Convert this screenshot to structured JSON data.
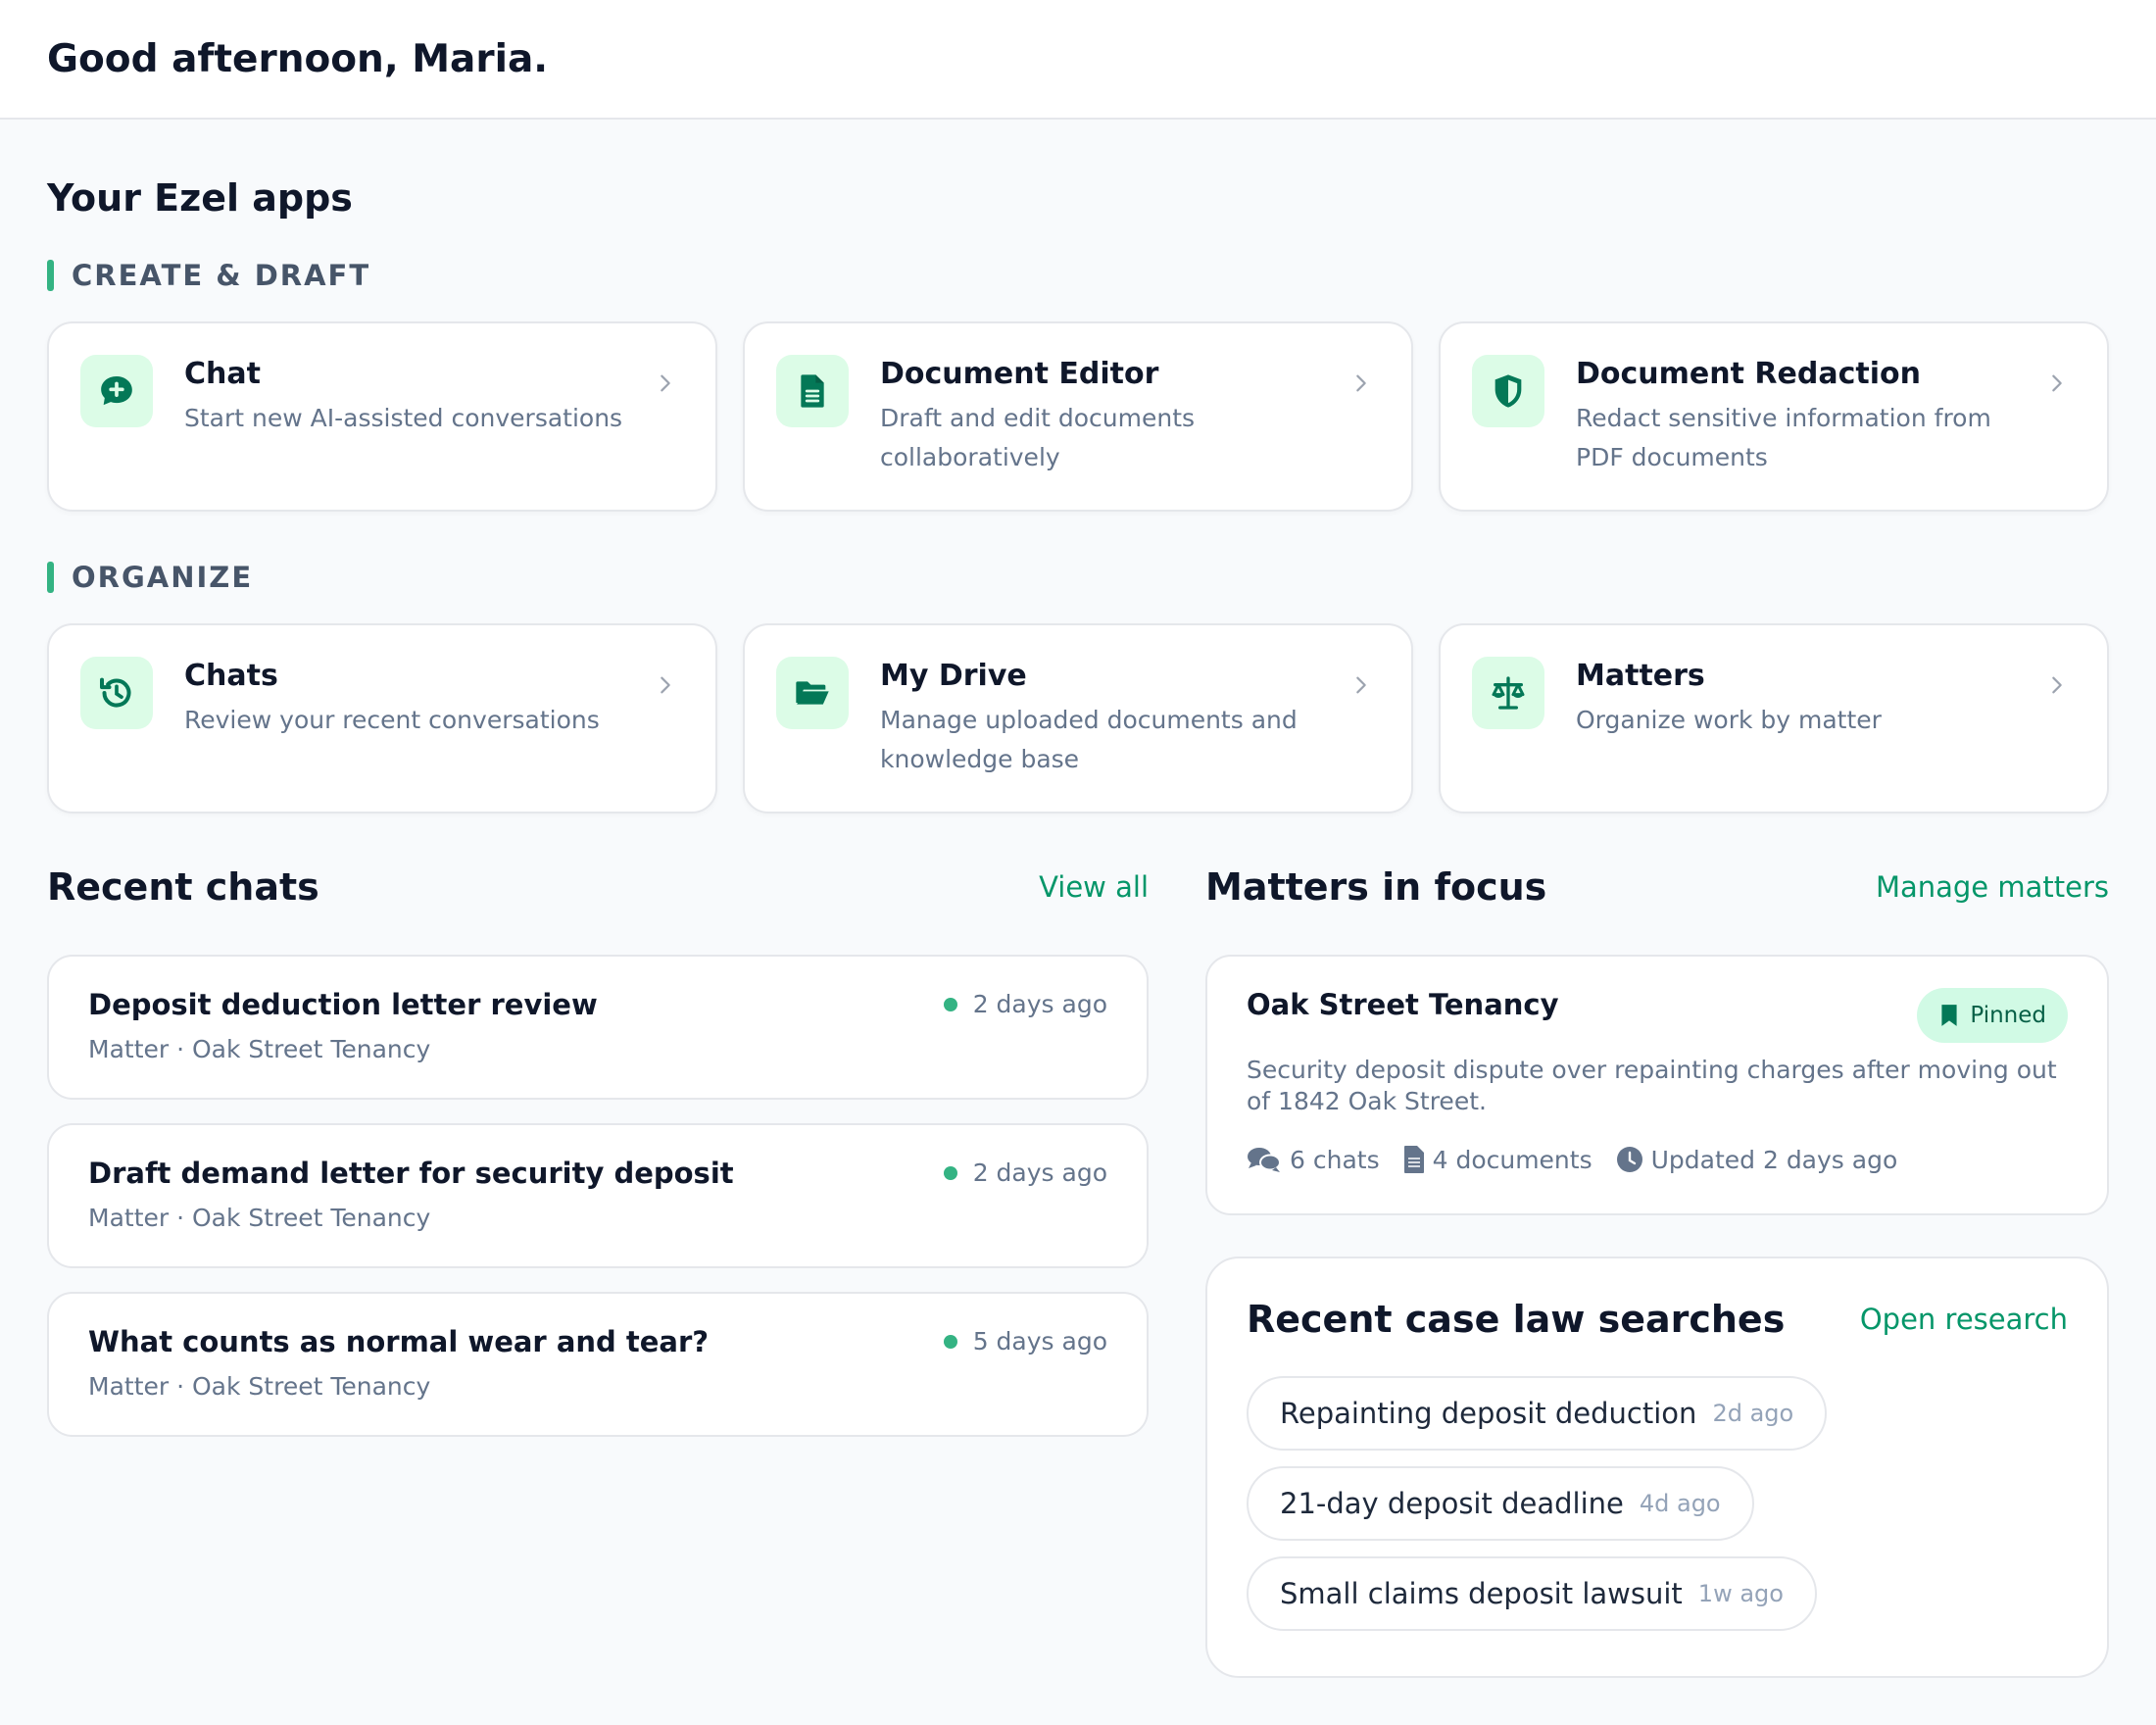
{
  "header": {
    "greeting": "Good afternoon, Maria."
  },
  "apps": {
    "title": "Your Ezel apps",
    "sections": [
      {
        "label": "CREATE & DRAFT",
        "items": [
          {
            "name": "Chat",
            "desc": "Start new AI-assisted conversations",
            "icon": "chat-plus-icon"
          },
          {
            "name": "Document Editor",
            "desc": "Draft and edit documents collaboratively",
            "icon": "document-icon"
          },
          {
            "name": "Document Redaction",
            "desc": "Redact sensitive information from PDF documents",
            "icon": "shield-icon"
          }
        ]
      },
      {
        "label": "ORGANIZE",
        "items": [
          {
            "name": "Chats",
            "desc": "Review your recent conversations",
            "icon": "history-icon"
          },
          {
            "name": "My Drive",
            "desc": "Manage uploaded documents and knowledge base",
            "icon": "folder-open-icon"
          },
          {
            "name": "Matters",
            "desc": "Organize work by matter",
            "icon": "scales-icon"
          }
        ]
      }
    ]
  },
  "recent_chats": {
    "title": "Recent chats",
    "view_all": "View all",
    "items": [
      {
        "title": "Deposit deduction letter review",
        "sub": "Matter · Oak Street Tenancy",
        "time": "2 days ago"
      },
      {
        "title": "Draft demand letter for security deposit",
        "sub": "Matter · Oak Street Tenancy",
        "time": "2 days ago"
      },
      {
        "title": "What counts as normal wear and tear?",
        "sub": "Matter · Oak Street Tenancy",
        "time": "5 days ago"
      }
    ]
  },
  "matters": {
    "title": "Matters in focus",
    "manage": "Manage matters",
    "card": {
      "name": "Oak Street Tenancy",
      "badge": "Pinned",
      "desc": "Security deposit dispute over repainting charges after moving out of 1842 Oak Street.",
      "chats": "6 chats",
      "documents": "4 documents",
      "updated": "Updated 2 days ago"
    }
  },
  "case_law": {
    "title": "Recent case law searches",
    "open": "Open research",
    "items": [
      {
        "query": "Repainting deposit deduction",
        "age": "2d ago"
      },
      {
        "query": "21-day deposit deadline",
        "age": "4d ago"
      },
      {
        "query": "Small claims deposit lawsuit",
        "age": "1w ago"
      }
    ]
  },
  "colors": {
    "accent": "#34b383",
    "link": "#059669",
    "icon_bg": "#dcfce7",
    "icon_fg": "#047857"
  }
}
